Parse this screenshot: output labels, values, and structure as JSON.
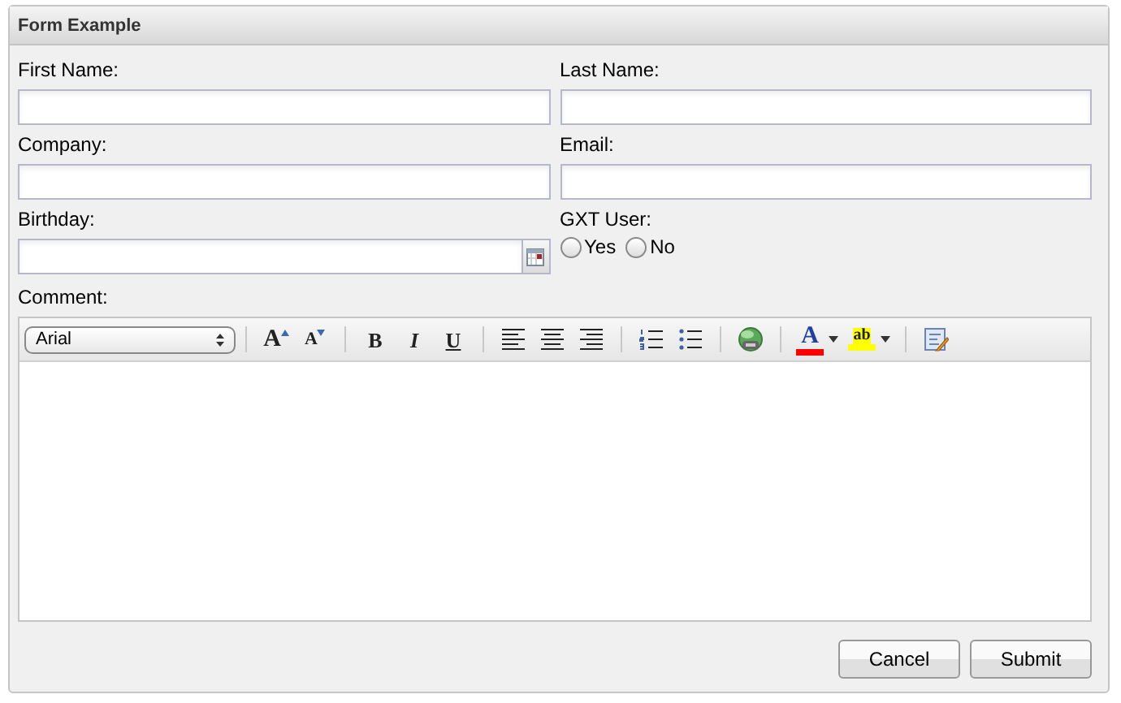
{
  "panel": {
    "title": "Form Example"
  },
  "fields": [
    {
      "label": "First Name:",
      "kind": "text"
    },
    {
      "label": "Last Name:",
      "kind": "text"
    },
    {
      "label": "Company:",
      "kind": "text"
    },
    {
      "label": "Email:",
      "kind": "text"
    },
    {
      "label": "Birthday:",
      "kind": "date"
    },
    {
      "label": "GXT User:",
      "kind": "radio",
      "options": [
        {
          "label": "Yes",
          "selected": false
        },
        {
          "label": "No",
          "selected": false
        }
      ]
    }
  ],
  "comment": {
    "label": "Comment:"
  },
  "toolbar": [
    {
      "kind": "select",
      "value": "Arial"
    },
    {
      "kind": "separator"
    },
    {
      "kind": "letter",
      "text": "A"
    },
    {
      "kind": "letter",
      "text": "A"
    },
    {
      "kind": "separator"
    },
    {
      "kind": "letter",
      "text": "B"
    },
    {
      "kind": "letter",
      "text": "I"
    },
    {
      "kind": "letter",
      "text": "U"
    },
    {
      "kind": "separator"
    },
    {
      "kind": "icon"
    },
    {
      "kind": "icon"
    },
    {
      "kind": "icon"
    },
    {
      "kind": "separator"
    },
    {
      "kind": "icon"
    },
    {
      "kind": "icon"
    },
    {
      "kind": "separator"
    },
    {
      "kind": "icon"
    },
    {
      "kind": "separator"
    },
    {
      "kind": "color",
      "text": "A",
      "color": "#ff0000"
    },
    {
      "kind": "color",
      "text": "ab",
      "color": "#ffff00"
    },
    {
      "kind": "separator"
    },
    {
      "kind": "icon"
    }
  ],
  "buttons": [
    "Cancel",
    "Submit"
  ]
}
